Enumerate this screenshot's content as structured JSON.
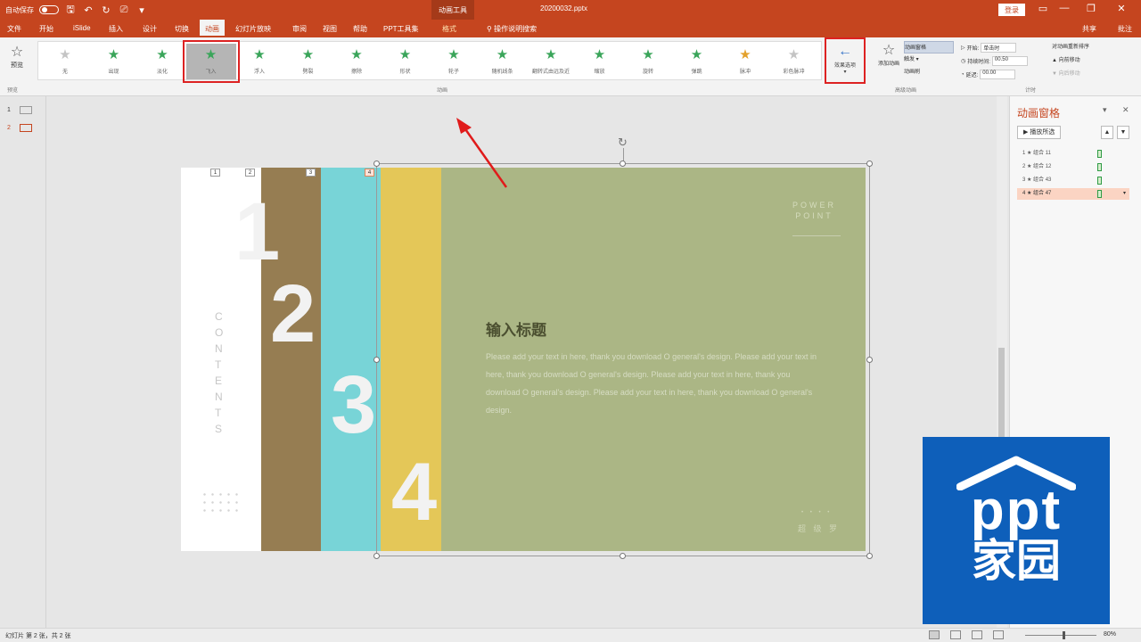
{
  "titlebar": {
    "autosave": "自动保存",
    "autosave_state": "关",
    "context_tab": "动画工具",
    "filename": "20200032.pptx",
    "signin": "登录",
    "minimize": "—",
    "restore": "❐",
    "close": "✕"
  },
  "tabs": [
    "文件",
    "开始",
    "iSlide",
    "插入",
    "设计",
    "切换",
    "动画",
    "幻灯片放映",
    "审阅",
    "视图",
    "帮助",
    "PPT工具集",
    "格式"
  ],
  "tell_me": "操作说明搜索",
  "share": "共享",
  "comment": "批注",
  "ribbon": {
    "preview": "预览",
    "preview_group": "预览",
    "gallery_label": "动画",
    "animations": [
      {
        "label": "无",
        "style": "grey"
      },
      {
        "label": "出现",
        "style": "green"
      },
      {
        "label": "淡化",
        "style": "green"
      },
      {
        "label": "飞入",
        "style": "green"
      },
      {
        "label": "浮入",
        "style": "green"
      },
      {
        "label": "劈裂",
        "style": "green"
      },
      {
        "label": "擦除",
        "style": "green"
      },
      {
        "label": "形状",
        "style": "green"
      },
      {
        "label": "轮子",
        "style": "green"
      },
      {
        "label": "随机线条",
        "style": "green"
      },
      {
        "label": "翻转式由远及近",
        "style": "green"
      },
      {
        "label": "缩放",
        "style": "green"
      },
      {
        "label": "旋转",
        "style": "green"
      },
      {
        "label": "弹跳",
        "style": "green"
      },
      {
        "label": "脉冲",
        "style": "gold"
      },
      {
        "label": "彩色脉冲",
        "style": "grey"
      }
    ],
    "effect_options": "效果选项",
    "add_animation": "添加动画",
    "adv": [
      "动画窗格",
      "触发 ▾",
      "动画刷"
    ],
    "adv_label": "高级动画",
    "timing": {
      "start_label": "开始:",
      "start_val": "单击时",
      "duration_label": "持续时间:",
      "duration_val": "00.50",
      "delay_label": "延迟:",
      "delay_val": "00.00",
      "group": "计时"
    },
    "reorder": [
      "对动画重新排序",
      "▲ 向前移动",
      "▼ 向后移动"
    ]
  },
  "thumbs": [
    {
      "num": "1",
      "icon": "☰"
    },
    {
      "num": "2",
      "icon": "▭"
    }
  ],
  "slide": {
    "numbers": [
      "1",
      "2",
      "3",
      "4"
    ],
    "tags": [
      "1",
      "2",
      "3",
      "4"
    ],
    "contents": "CONTENTS",
    "power": "POWER",
    "point": "POINT",
    "title": "输入标题",
    "body": "Please add your text in here, thank you download O general's design. Please add your text in here, thank you download O general's design. Please add your text in here, thank you download O general's design. Please add your text in here, thank you download O general's design.",
    "foot_dots": "• • • •",
    "foot": "超 级 罗"
  },
  "pane": {
    "title": "动画窗格",
    "play": "▶ 播放所选",
    "up": "▲",
    "down": "▼",
    "collapse": "▾",
    "close": "✕",
    "items": [
      "1 ★ 组合 11",
      "2 ★ 组合 12",
      "3 ★ 组合 43",
      "4 ★ 组合 47"
    ]
  },
  "status": {
    "left": "幻灯片 第 2 张，共 2 张",
    "zoom": "80%"
  },
  "watermark": {
    "brand": "ppt",
    "sub": "家园"
  },
  "colors": {
    "accent": "#c5451f",
    "slide_bg": "#abb685",
    "brown": "#967d52",
    "cyan": "#78d4d7",
    "yellow": "#e4c758",
    "watermark": "#0e5fba"
  }
}
